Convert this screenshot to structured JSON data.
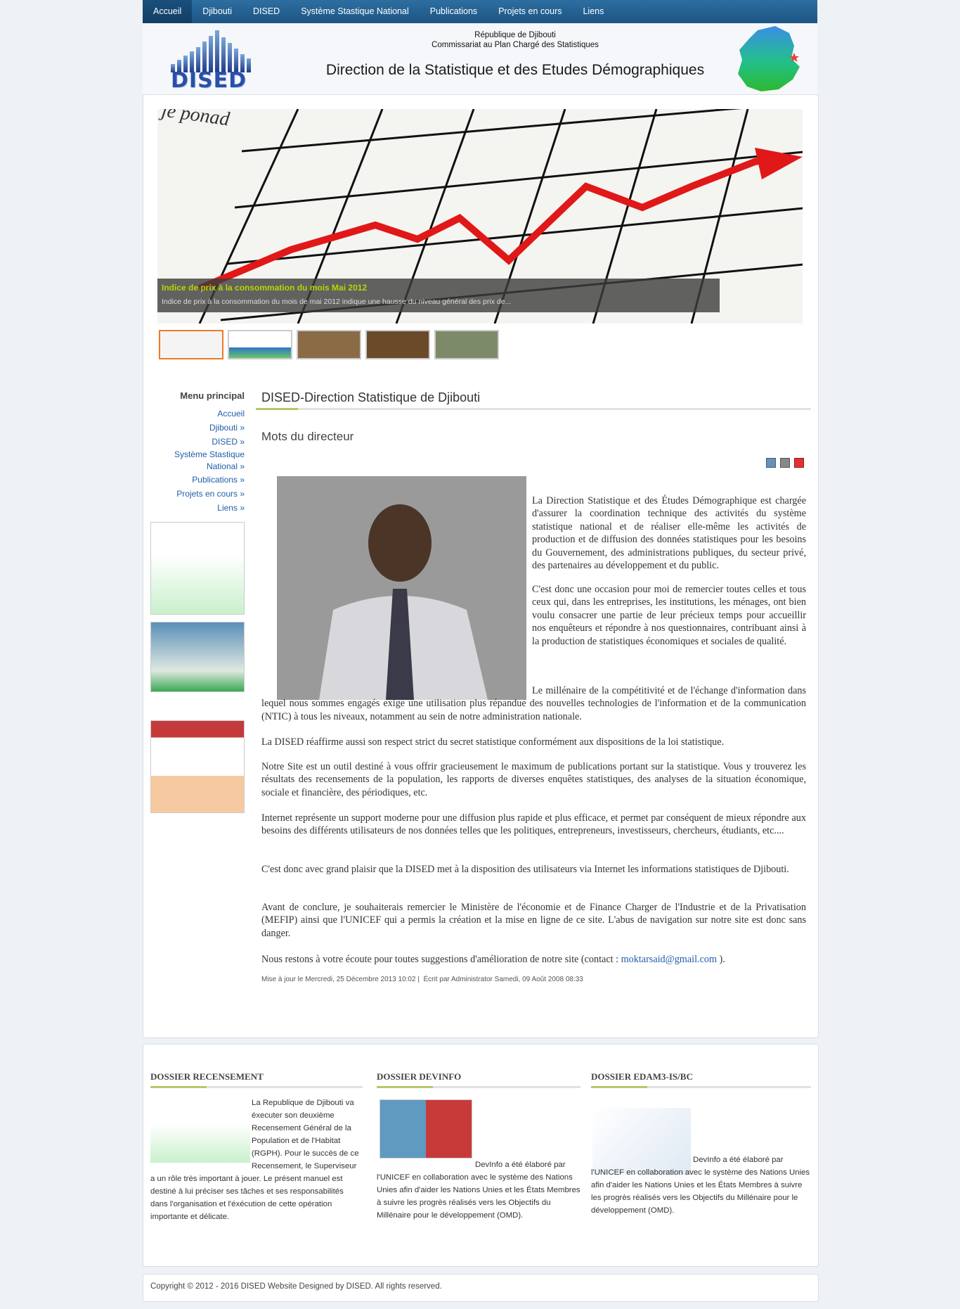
{
  "nav": [
    "Accueil",
    "Djibouti",
    "DISED",
    "Système Stastique National",
    "Publications",
    "Projets en cours",
    "Liens"
  ],
  "header": {
    "logo_text": "DISED",
    "republic": "République de Djibouti",
    "commissariat": "Commissariat au Plan Chargé des Statistiques",
    "title": "Direction de la Statistique et des Etudes Démographiques"
  },
  "slider": {
    "title": "Indice de prix à la consommation du mois Mai 2012",
    "text": "Indice de prix à la consommation du mois de mai 2012 indique une hausse du niveau général des prix de..."
  },
  "sidebar": {
    "title": "Menu principal",
    "items": [
      "Accueil",
      "Djibouti »",
      "DISED »",
      "Système Stastique",
      "National »",
      "Publications »",
      "Projets en cours »",
      "Liens »"
    ]
  },
  "article": {
    "section_title": "DISED-Direction Statistique de Djibouti",
    "subtitle": "Mots du directeur",
    "p1": "La Direction Statistique et des Études Démographique est chargée d'assurer la coordination technique des activités du système statistique national et de réaliser elle-même les activités de production et de diffusion des données statistiques pour les besoins du Gouvernement, des administrations publiques, du secteur privé, des partenaires au développement et du public.",
    "p2": "C'est donc une occasion pour moi de remercier toutes celles et tous ceux qui, dans les entreprises, les institutions, les ménages, ont bien voulu consacrer une partie de leur précieux temps pour accueillir nos enquêteurs et répondre à nos questionnaires, contribuant ainsi à la production de statistiques économiques et sociales de qualité.",
    "p3": "Le millénaire de la compétitivité et de l'échange d'information dans lequel nous sommes engagés exige une utilisation plus répandue des nouvelles technologies de l'information et de la communication (NTIC) à tous les niveaux, notamment au sein de notre administration nationale.",
    "p4": "La DISED réaffirme aussi son respect strict du secret statistique conformément aux dispositions de la loi statistique.",
    "p5": "Notre Site est un outil destiné à vous offrir gracieusement le maximum de publications portant sur la statistique. Vous y trouverez les résultats des recensements de la population, les rapports de diverses enquêtes statistiques, des analyses de la situation économique, sociale et financière, des périodiques, etc.",
    "p6": "Internet représente un support moderne pour une diffusion plus rapide et plus efficace, et permet par conséquent de mieux répondre aux besoins des différents utilisateurs de nos données telles que les politiques, entrepreneurs, investisseurs, chercheurs, étudiants, etc....",
    "p7": "C'est donc avec grand plaisir que la DISED met à la disposition des utilisateurs via Internet les informations statistiques de Djibouti.",
    "p8": "Avant de conclure, je souhaiterais remercier le Ministère de l'économie et de Finance Charger de l'Industrie et de la Privatisation (MEFIP) ainsi que l'UNICEF qui a permis la création et la mise en ligne de ce site. L'abus de navigation sur notre site est donc sans danger.",
    "p9_a": "Nous restons à votre écoute pour toutes suggestions d'amélioration de notre site (contact : ",
    "p9_email": "moktarsaid@gmail.com",
    "p9_b": " ).",
    "updated": "Mise à jour le Mercredi, 25 Décembre 2013 10:02",
    "written": "Écrit par Administrator Samedi, 09 Août 2008 08:33"
  },
  "bottom": {
    "col1_title": "DOSSIER RECENSEMENT",
    "col1_text": "La Republique de Djibouti va éxecuter son deuxième Recensement Général de la Population et de l'Habitat (RGPH). Pour le succès de ce Recensement, le Superviseur a un rôle très important à jouer. Le présent manuel est destiné à lui préciser ses tâches et ses responsabilités dans l'organisation et l'éxécution de cette opération importante et délicate.",
    "col2_title": "DOSSIER DEVINFO",
    "col2_text": "DevInfo a été élaboré par l'UNICEF en collaboration avec le système des Nations Unies  afin d'aider les Nations Unies  et les États Membres à suivre les progrès réalisés vers les Objectifs du Millénaire pour le développement (OMD).",
    "col3_title": "DOSSIER EDAM3-IS/BC",
    "col3_text": "DevInfo a été élaboré par l'UNICEF en collaboration avec le système des Nations Unies afin d'aider les Nations Unies et les États Membres à suivre les progrès réalisés vers les Objectifs du Millénaire pour le développement (OMD)."
  },
  "footer": "Copyright © 2012 - 2016 DISED Website Designed by DISED. All rights reserved."
}
